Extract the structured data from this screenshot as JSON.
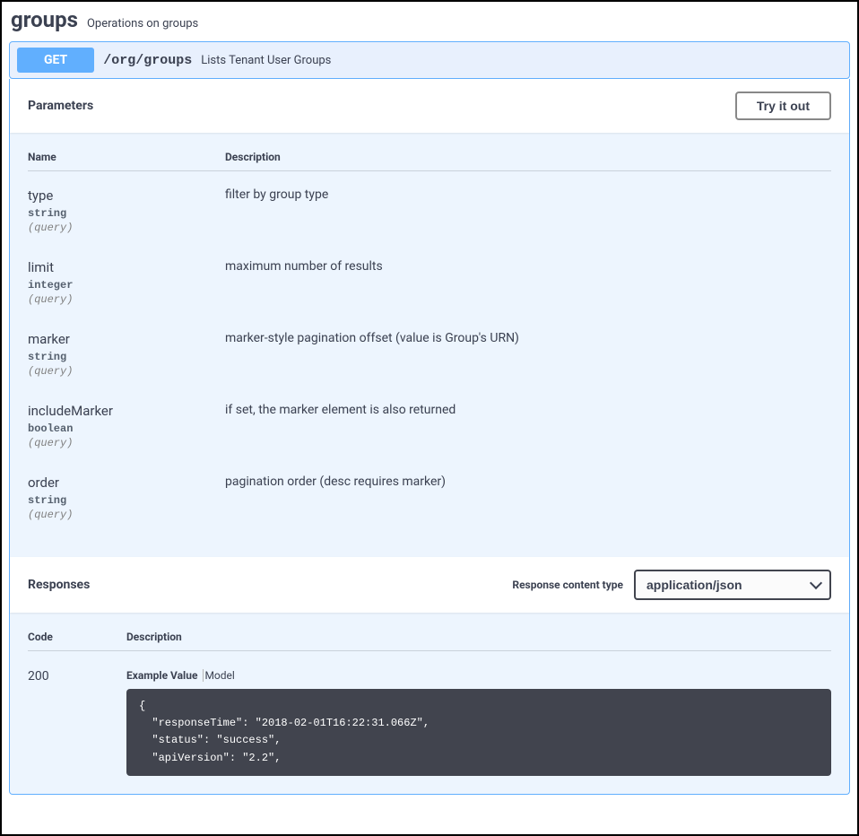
{
  "header": {
    "title": "groups",
    "subtitle": "Operations on groups"
  },
  "operation": {
    "method": "GET",
    "path": "/org/groups",
    "summary": "Lists Tenant User Groups"
  },
  "sections": {
    "parameters_label": "Parameters",
    "try_it_out_label": "Try it out",
    "responses_label": "Responses",
    "response_content_type_label": "Response content type"
  },
  "columns": {
    "name": "Name",
    "description": "Description",
    "code": "Code"
  },
  "parameters": [
    {
      "name": "type",
      "type": "string",
      "in": "(query)",
      "description": "filter by group type"
    },
    {
      "name": "limit",
      "type": "integer",
      "in": "(query)",
      "description": "maximum number of results"
    },
    {
      "name": "marker",
      "type": "string",
      "in": "(query)",
      "description": "marker-style pagination offset (value is Group's URN)"
    },
    {
      "name": "includeMarker",
      "type": "boolean",
      "in": "(query)",
      "description": "if set, the marker element is also returned"
    },
    {
      "name": "order",
      "type": "string",
      "in": "(query)",
      "description": "pagination order (desc requires marker)"
    }
  ],
  "content_type": {
    "selected": "application/json"
  },
  "response": {
    "code": "200",
    "tabs": {
      "example_value": "Example Value",
      "model": "Model"
    },
    "example_lines": [
      "{",
      "  \"responseTime\": \"2018-02-01T16:22:31.066Z\",",
      "  \"status\": \"success\",",
      "  \"apiVersion\": \"2.2\","
    ]
  }
}
